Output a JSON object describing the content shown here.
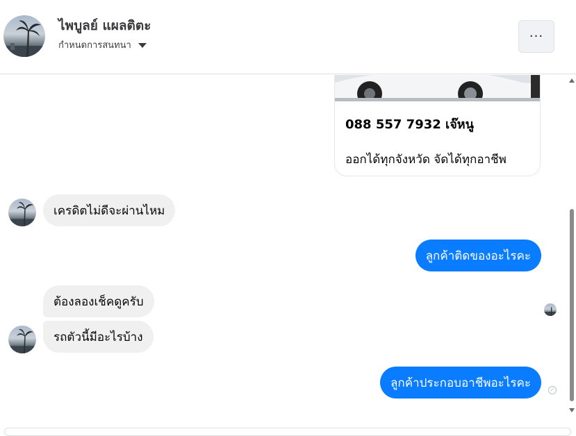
{
  "header": {
    "contact_name": "ไพบูลย์ แผลติตะ",
    "subtitle": "กำหนดการสนทนา",
    "more_label": "···"
  },
  "card": {
    "phone": "088 557 7932 เจ๊หนู",
    "description": "ออกได้ทุกจังหวัด จัดได้ทุกอาชีพ"
  },
  "messages": [
    {
      "from": "contact",
      "text": "เครดิตไม่ดีจะผ่านไหม"
    },
    {
      "from": "me",
      "text": "ลูกค้าติดของอะไรคะ"
    },
    {
      "from": "contact",
      "text": "ต้องลองเช็คดูครับ"
    },
    {
      "from": "contact",
      "text": "รถตัวนี้มีอะไรบ้าง"
    },
    {
      "from": "me",
      "text": "ลูกค้าประกอบอาชีพอะไรคะ"
    }
  ],
  "colors": {
    "outgoing_bubble": "#0a7cff",
    "incoming_bubble": "#f0f0f0",
    "text": "#050505"
  },
  "icons": {
    "more": "more-horizontal-icon",
    "caret": "caret-down-icon",
    "sent": "sent-check-icon"
  }
}
